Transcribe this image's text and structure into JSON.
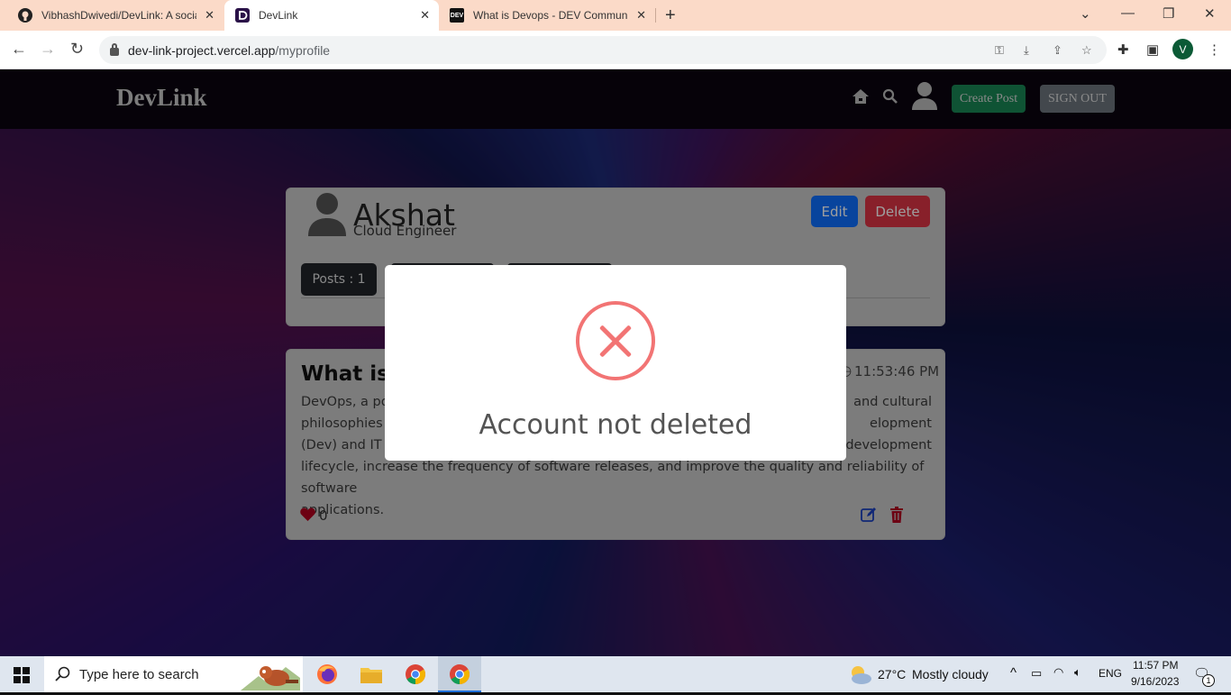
{
  "browser": {
    "tabs": [
      {
        "title": "VibhashDwivedi/DevLink: A socia",
        "favicon": "github-icon",
        "active": false
      },
      {
        "title": "DevLink",
        "favicon": "devlink-icon",
        "active": true
      },
      {
        "title": "What is Devops - DEV Communit",
        "favicon": "dev-icon",
        "active": false
      }
    ],
    "dev_badge": "DEV",
    "url_host": "dev-link-project.vercel.app",
    "url_path": "/myprofile",
    "profile_initial": "V"
  },
  "site": {
    "brand": "DevLink",
    "create_post_label": "Create Post",
    "sign_out_label": "SIGN OUT",
    "colors": {
      "create": "#198754",
      "signout": "#6c757d",
      "edit": "#0d6efd",
      "delete": "#dc3545",
      "error": "#f27474"
    }
  },
  "profile": {
    "name": "Akshat",
    "role": "Cloud Engineer",
    "edit_label": "Edit",
    "delete_label": "Delete",
    "posts_label": "Posts : 1"
  },
  "post": {
    "title_visible": "What is",
    "time": "11:53:46 PM",
    "body_lines": [
      [
        "DevOps, a por",
        "and cultural"
      ],
      [
        "philosophies t",
        "elopment"
      ],
      [
        "(Dev) and IT o",
        "development"
      ],
      [
        "lifecycle, increase the frequency of software releases, and improve the quality and reliability of software",
        ""
      ],
      [
        "applications.",
        ""
      ]
    ],
    "likes": "0"
  },
  "modal": {
    "title": "Account not deleted"
  },
  "taskbar": {
    "search_placeholder": "Type here to search",
    "weather_temp": "27°C",
    "weather_desc": "Mostly cloudy",
    "lang": "ENG",
    "time": "11:57 PM",
    "date": "9/16/2023",
    "notif_count": "1"
  }
}
